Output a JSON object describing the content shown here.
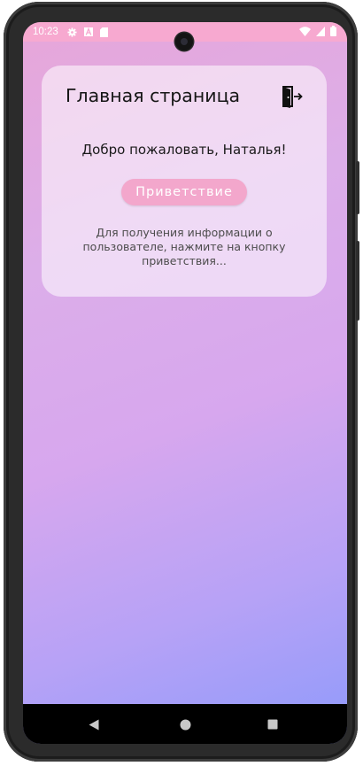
{
  "status_bar": {
    "time": "10:23",
    "left_icons": [
      "gear-icon",
      "a-icon",
      "sd-card-icon"
    ],
    "right_icons": [
      "wifi-icon",
      "signal-icon",
      "battery-icon"
    ]
  },
  "card": {
    "title": "Главная страница",
    "logout_icon": "logout-icon",
    "welcome_text": "Добро пожаловать, Наталья!",
    "greet_button_label": "Приветствие",
    "hint_text": "Для получения информации о пользователе, нажмите на кнопку приветствия..."
  },
  "nav_bar": {
    "buttons": [
      "back-icon",
      "home-icon",
      "recents-icon"
    ]
  },
  "colors": {
    "status_bar": "#f7a9d0",
    "button": "#f3a7cc",
    "gradient_top": "#e7a6d9",
    "gradient_bottom": "#8f9afb"
  }
}
